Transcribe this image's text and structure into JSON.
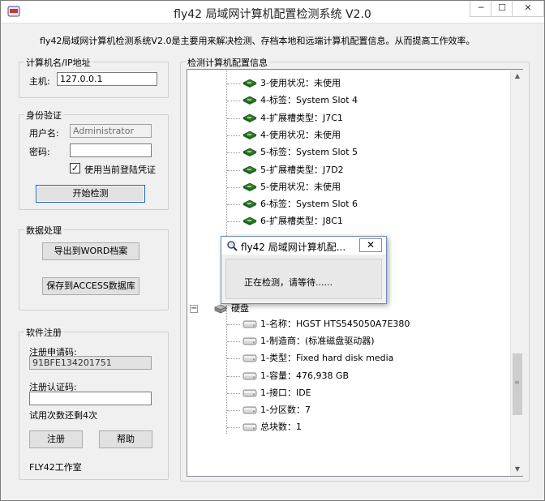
{
  "window": {
    "title": "fly42 局域网计算机配置检测系统 V2.0",
    "controls": {
      "minimize": "─",
      "maximize": "☐",
      "close": "✕"
    }
  },
  "intro": "fly42局域网计算机检测系统V2.0是主要用来解决检测、存档本地和远端计算机配置信息。从而提高工作效率。",
  "host_group": {
    "legend": "计算机名/IP地址",
    "host_label": "主机:",
    "host_value": "127.0.0.1"
  },
  "auth_group": {
    "legend": "身份验证",
    "user_label": "用户名:",
    "user_value": "Administrator",
    "password_label": "密码:",
    "password_value": "",
    "use_credentials_label": "使用当前登陆凭证",
    "use_credentials_checked": "✓",
    "start_button": "开始检测"
  },
  "data_group": {
    "legend": "数据处理",
    "export_word": "导出到WORD档案",
    "save_access": "保存到ACCESS数据库"
  },
  "register_group": {
    "legend": "软件注册",
    "apply_code_label": "注册申请码:",
    "apply_code_value": "91BFE134201751",
    "auth_code_label": "注册认证码:",
    "auth_code_value": "",
    "trial_text": "试用次数还剩4次",
    "register_button": "注册",
    "help_button": "帮助",
    "studio": "FLY42工作室"
  },
  "tree_panel": {
    "legend": "检测计算机配置信息",
    "slot_items": [
      "3-使用状况：未使用",
      "4-标签：System Slot 4",
      "4-扩展槽类型：J7C1",
      "4-使用状况：未使用",
      "5-标签：System Slot 5",
      "5-扩展槽类型：J7D2",
      "5-使用状况：未使用",
      "6-标签：System Slot 6",
      "6-扩展槽类型：J8C1"
    ],
    "disk_node": "硬盘",
    "disk_items": [
      "1-名称：HGST HTS545050A7E380",
      "1-制造商：(标准磁盘驱动器)",
      "1-类型：Fixed hard disk media",
      "1-容量：476,938 GB",
      "1-接口：IDE",
      "1-分区数：7",
      "总块数：1"
    ],
    "collapse_symbol": "−"
  },
  "dialog": {
    "title": "fly42 局域网计算机配...",
    "close": "✕",
    "message": "正在检测，请等待......"
  },
  "colors": {
    "slot_icon": "#2e7d32",
    "disk_icon": "#8a8a8a",
    "accent": "#1f5fbf"
  }
}
